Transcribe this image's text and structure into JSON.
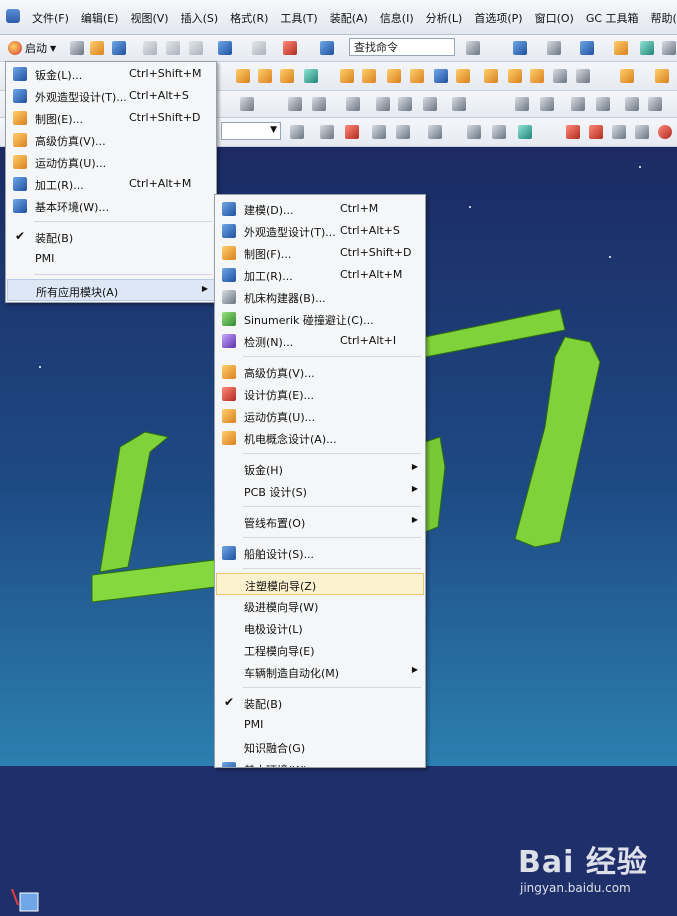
{
  "menubar": {
    "items": [
      "文件(F)",
      "编辑(E)",
      "视图(V)",
      "插入(S)",
      "格式(R)",
      "工具(T)",
      "装配(A)",
      "信息(I)",
      "分析(L)",
      "首选项(P)",
      "窗口(O)",
      "GC 工具箱",
      "帮助(H)"
    ]
  },
  "toolbar": {
    "start_label": "启动",
    "search_placeholder": "查找命令"
  },
  "start_menu": {
    "items": [
      {
        "label": "钣金(L)...",
        "shortcut": "Ctrl+Shift+M",
        "icon": "sheet-metal-icon"
      },
      {
        "label": "外观造型设计(T)...",
        "shortcut": "Ctrl+Alt+S",
        "icon": "shape-studio-icon"
      },
      {
        "label": "制图(E)...",
        "shortcut": "Ctrl+Shift+D",
        "icon": "drafting-icon"
      },
      {
        "label": "高级仿真(V)...",
        "shortcut": "",
        "icon": "advanced-simulation-icon"
      },
      {
        "label": "运动仿真(U)...",
        "shortcut": "",
        "icon": "motion-simulation-icon"
      },
      {
        "label": "加工(R)...",
        "shortcut": "Ctrl+Alt+M",
        "icon": "manufacturing-icon"
      },
      {
        "label": "基本环境(W)...",
        "shortcut": "",
        "icon": "gateway-icon"
      }
    ],
    "checked_items": [
      "装配(B)",
      "PMI"
    ],
    "all_apps": "所有应用模块(A)"
  },
  "apps_menu": {
    "group1": [
      {
        "label": "建模(D)...",
        "shortcut": "Ctrl+M",
        "icon": "modeling-icon"
      },
      {
        "label": "外观造型设计(T)...",
        "shortcut": "Ctrl+Alt+S",
        "icon": "shape-studio-icon"
      },
      {
        "label": "制图(F)...",
        "shortcut": "Ctrl+Shift+D",
        "icon": "drafting-icon"
      },
      {
        "label": "加工(R)...",
        "shortcut": "Ctrl+Alt+M",
        "icon": "manufacturing-icon"
      },
      {
        "label": "机床构建器(B)...",
        "shortcut": "",
        "icon": "machine-builder-icon"
      },
      {
        "label": "Sinumerik 碰撞避让(C)...",
        "shortcut": "",
        "icon": "collision-icon"
      },
      {
        "label": "检测(N)...",
        "shortcut": "Ctrl+Alt+I",
        "icon": "inspection-icon"
      }
    ],
    "group2": [
      {
        "label": "高级仿真(V)...",
        "icon": "advanced-simulation-icon"
      },
      {
        "label": "设计仿真(E)...",
        "icon": "design-simulation-icon"
      },
      {
        "label": "运动仿真(U)...",
        "icon": "motion-simulation-icon"
      },
      {
        "label": "机电概念设计(A)...",
        "icon": "mechatronics-icon"
      }
    ],
    "group3": [
      "钣金(H)",
      "PCB 设计(S)"
    ],
    "group4": [
      "管线布置(O)"
    ],
    "group5": [
      {
        "label": "船舶设计(S)...",
        "icon": "ship-design-icon"
      }
    ],
    "group6": [
      "注塑模向导(Z)",
      "级进模向导(W)",
      "电极设计(L)",
      "工程模向导(E)",
      "车辆制造自动化(M)"
    ],
    "group7": [
      "装配(B)",
      "PMI",
      "知识融合(G)",
      "基本环境(W)"
    ]
  },
  "watermark": {
    "logo": "Bai 经验",
    "url": "jingyan.baidu.com"
  },
  "colors": {
    "viewport_top": "#1c2a63",
    "viewport_bottom": "#2c7fb0",
    "model_green": "#7fd23a",
    "highlight": "#fdf2cf"
  }
}
